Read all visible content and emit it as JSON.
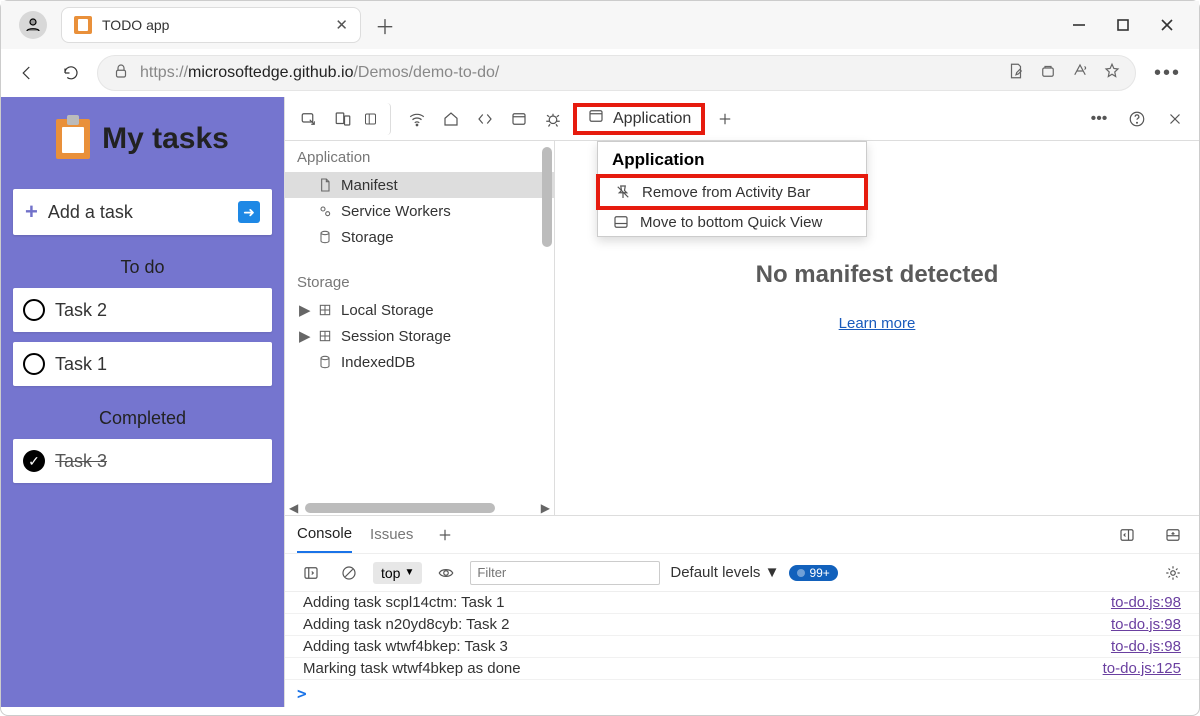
{
  "browser": {
    "tab_title": "TODO app",
    "url_prefix": "https://",
    "url_host": "microsoftedge.github.io",
    "url_path": "/Demos/demo-to-do/"
  },
  "app": {
    "title": "My tasks",
    "add_label": "Add a task",
    "todo_label": "To do",
    "completed_label": "Completed",
    "todo_items": [
      "Task 2",
      "Task 1"
    ],
    "done_items": [
      "Task 3"
    ]
  },
  "devtools": {
    "active_tab": "Application",
    "sidebar": {
      "cat_app": "Application",
      "cat_storage": "Storage",
      "app_items": [
        "Manifest",
        "Service Workers",
        "Storage"
      ],
      "storage_items": [
        "Local Storage",
        "Session Storage",
        "IndexedDB"
      ]
    },
    "manifest_msg": "No manifest detected",
    "learn_more": "Learn more",
    "context_menu": {
      "title": "Application",
      "remove": "Remove from Activity Bar",
      "move": "Move to bottom Quick View"
    },
    "console": {
      "tab_console": "Console",
      "tab_issues": "Issues",
      "top_label": "top",
      "filter_placeholder": "Filter",
      "levels": "Default levels",
      "badge": "99+",
      "rows": [
        {
          "msg": "Adding task scpl14ctm: Task 1",
          "src": "to-do.js:98"
        },
        {
          "msg": "Adding task n20yd8cyb: Task 2",
          "src": "to-do.js:98"
        },
        {
          "msg": "Adding task wtwf4bkep: Task 3",
          "src": "to-do.js:98"
        },
        {
          "msg": "Marking task wtwf4bkep as done",
          "src": "to-do.js:125"
        }
      ]
    }
  }
}
